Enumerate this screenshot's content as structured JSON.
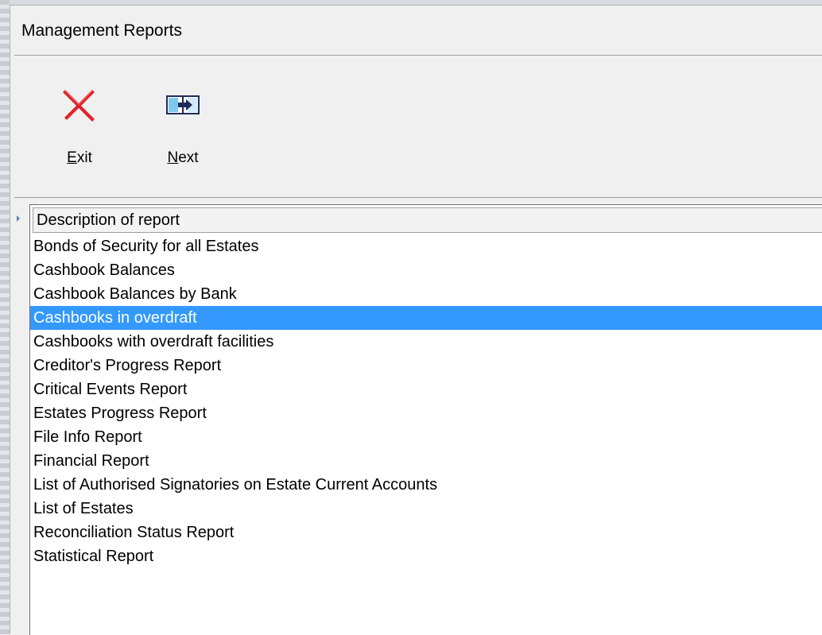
{
  "window": {
    "title": "Management Reports"
  },
  "toolbar": {
    "exit": {
      "label_accel": "E",
      "label_rest": "xit",
      "icon": "red-x-icon",
      "icon_color": "#e0232a"
    },
    "next": {
      "label_accel": "N",
      "label_rest": "ext",
      "icon": "next-report-icon"
    }
  },
  "list": {
    "header": "Description of report",
    "selected_index": 3,
    "selection_color": "#3399ff",
    "items": [
      "Bonds of Security for all Estates",
      "Cashbook Balances",
      "Cashbook Balances by Bank",
      "Cashbooks in overdraft",
      "Cashbooks with overdraft facilities",
      "Creditor's Progress Report",
      "Critical Events Report",
      "Estates Progress Report",
      "File Info Report",
      "Financial Report",
      "List of Authorised Signatories on Estate Current Accounts",
      "List of Estates",
      "Reconciliation Status Report",
      "Statistical Report"
    ]
  }
}
